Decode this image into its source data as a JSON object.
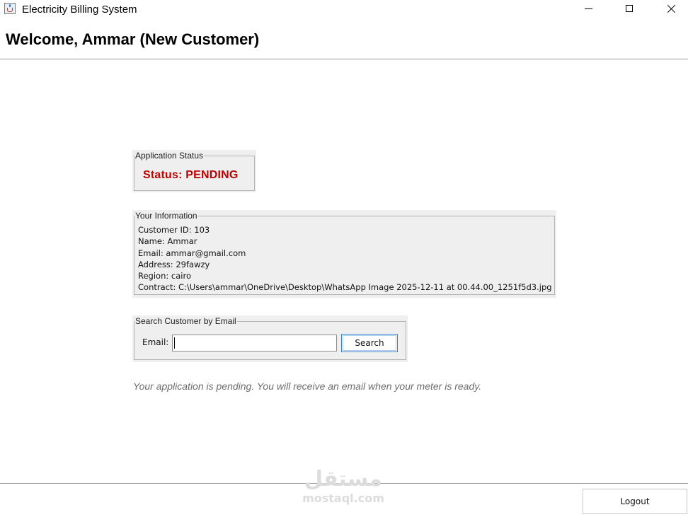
{
  "window": {
    "title": "Electricity Billing System",
    "icon": "java-cup-icon"
  },
  "header": {
    "welcome": "Welcome, Ammar (New Customer)"
  },
  "status_panel": {
    "legend": "Application Status",
    "status": "Status: PENDING",
    "status_color": "#c00000"
  },
  "info_panel": {
    "legend": "Your Information",
    "lines": [
      "Customer ID: 103",
      "Name: Ammar",
      "Email: ammar@gmail.com",
      "Address: 29fawzy",
      "Region: cairo",
      "Contract: C:\\Users\\ammar\\OneDrive\\Desktop\\WhatsApp Image 2025-12-11 at 00.44.00_1251f5d3.jpg"
    ]
  },
  "search_panel": {
    "legend": "Search Customer by Email",
    "email_label": "Email:",
    "email_value": "",
    "search_label": "Search"
  },
  "message": "Your application is pending. You will receive an email when your meter is ready.",
  "footer": {
    "logout_label": "Logout"
  },
  "watermark": {
    "arabic": "مستقل",
    "latin": "mostaql.com"
  }
}
